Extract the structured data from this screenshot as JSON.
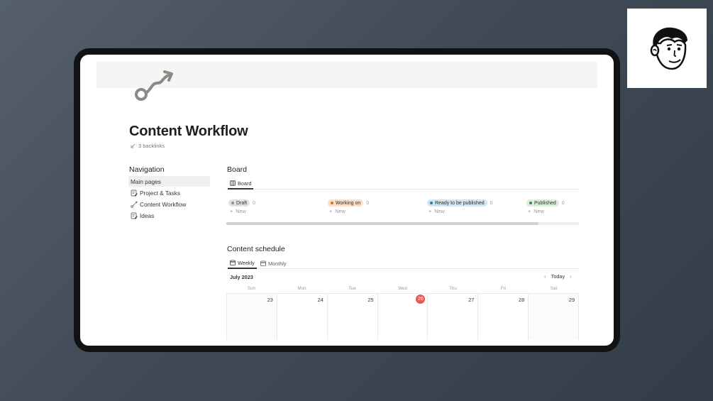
{
  "page": {
    "title": "Content Workflow",
    "backlinks": "3 backlinks",
    "icon": "workflow-route-icon"
  },
  "navigation": {
    "heading": "Navigation",
    "items": [
      {
        "label": "Main pages",
        "icon": "",
        "active": true
      },
      {
        "label": "Project & Tasks",
        "icon": "page-edit-icon",
        "active": false
      },
      {
        "label": "Content Workflow",
        "icon": "workflow-route-icon",
        "active": false
      },
      {
        "label": "Ideas",
        "icon": "page-edit-icon",
        "active": false
      }
    ]
  },
  "board": {
    "title": "Board",
    "view_tab": "Board",
    "columns": [
      {
        "label": "Draft",
        "count": "0",
        "color": "#e3e2e0",
        "dot": "#91918e"
      },
      {
        "label": "Working on",
        "count": "0",
        "color": "#fadec9",
        "dot": "#d9730d"
      },
      {
        "label": "Ready to be published",
        "count": "0",
        "color": "#d3e5ef",
        "dot": "#337ea9"
      },
      {
        "label": "Published",
        "count": "0",
        "color": "#dbeddb",
        "dot": "#448361"
      }
    ],
    "new_label": "New"
  },
  "schedule": {
    "title": "Content schedule",
    "tabs": [
      {
        "label": "Weekly",
        "active": true
      },
      {
        "label": "Monthly",
        "active": false
      }
    ],
    "month": "July 2023",
    "today_label": "Today",
    "weekdays": [
      "Sun",
      "Mon",
      "Tue",
      "Wed",
      "Thu",
      "Fri",
      "Sat"
    ],
    "days": [
      "23",
      "24",
      "25",
      "26",
      "27",
      "28",
      "29"
    ],
    "today_index": 3,
    "today_color": "#eb5757"
  }
}
